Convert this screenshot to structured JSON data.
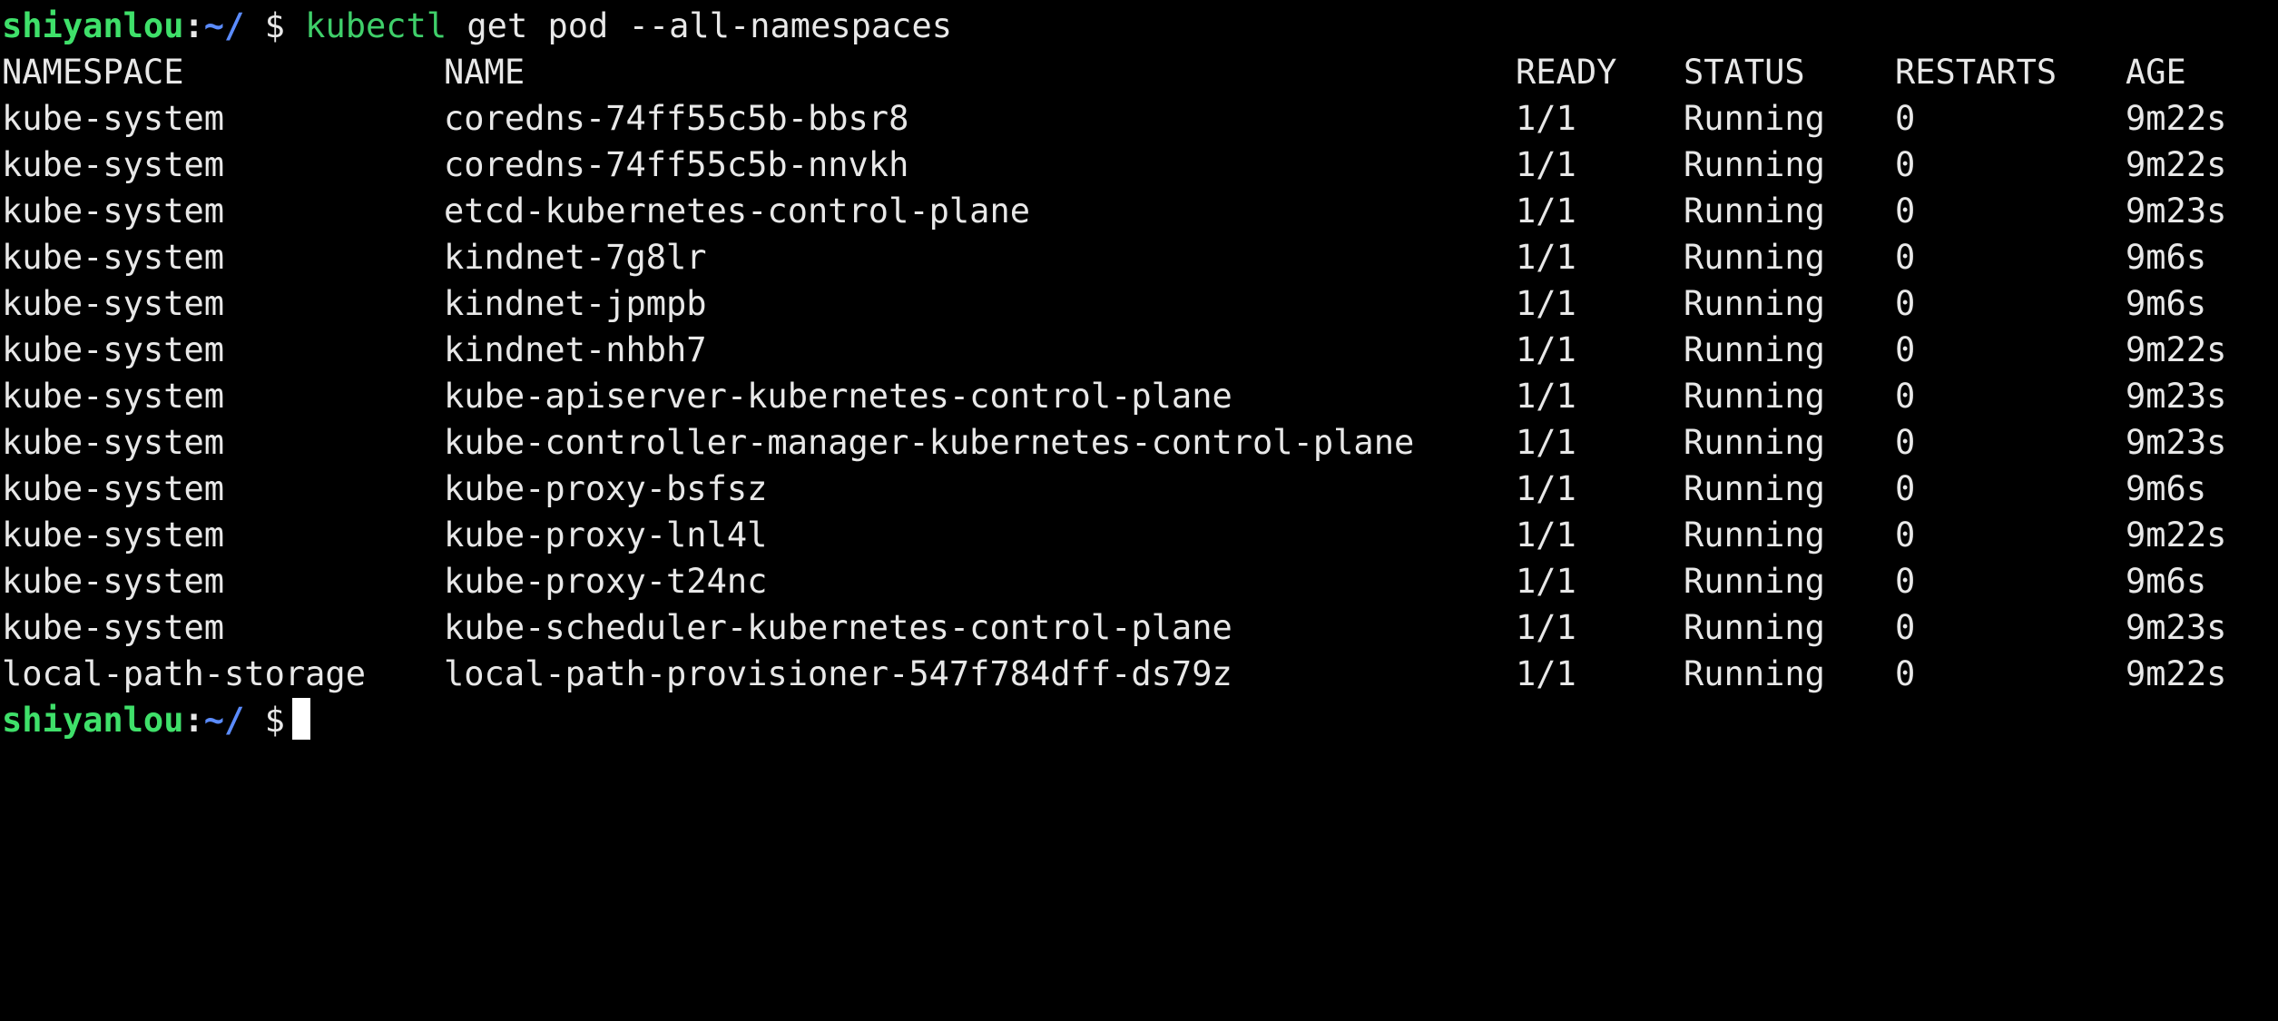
{
  "prompt": {
    "user_host": "shiyanlou",
    "colon": ":",
    "path": "~/",
    "dollar": "$"
  },
  "command": {
    "name": "kubectl",
    "args": "get pod --all-namespaces"
  },
  "table": {
    "headers": {
      "namespace": "NAMESPACE",
      "name": "NAME",
      "ready": "READY",
      "status": "STATUS",
      "restarts": "RESTARTS",
      "age": "AGE"
    },
    "rows": [
      {
        "namespace": "kube-system",
        "name": "coredns-74ff55c5b-bbsr8",
        "ready": "1/1",
        "status": "Running",
        "restarts": "0",
        "age": "9m22s"
      },
      {
        "namespace": "kube-system",
        "name": "coredns-74ff55c5b-nnvkh",
        "ready": "1/1",
        "status": "Running",
        "restarts": "0",
        "age": "9m22s"
      },
      {
        "namespace": "kube-system",
        "name": "etcd-kubernetes-control-plane",
        "ready": "1/1",
        "status": "Running",
        "restarts": "0",
        "age": "9m23s"
      },
      {
        "namespace": "kube-system",
        "name": "kindnet-7g8lr",
        "ready": "1/1",
        "status": "Running",
        "restarts": "0",
        "age": "9m6s"
      },
      {
        "namespace": "kube-system",
        "name": "kindnet-jpmpb",
        "ready": "1/1",
        "status": "Running",
        "restarts": "0",
        "age": "9m6s"
      },
      {
        "namespace": "kube-system",
        "name": "kindnet-nhbh7",
        "ready": "1/1",
        "status": "Running",
        "restarts": "0",
        "age": "9m22s"
      },
      {
        "namespace": "kube-system",
        "name": "kube-apiserver-kubernetes-control-plane",
        "ready": "1/1",
        "status": "Running",
        "restarts": "0",
        "age": "9m23s"
      },
      {
        "namespace": "kube-system",
        "name": "kube-controller-manager-kubernetes-control-plane",
        "ready": "1/1",
        "status": "Running",
        "restarts": "0",
        "age": "9m23s"
      },
      {
        "namespace": "kube-system",
        "name": "kube-proxy-bsfsz",
        "ready": "1/1",
        "status": "Running",
        "restarts": "0",
        "age": "9m6s"
      },
      {
        "namespace": "kube-system",
        "name": "kube-proxy-lnl4l",
        "ready": "1/1",
        "status": "Running",
        "restarts": "0",
        "age": "9m22s"
      },
      {
        "namespace": "kube-system",
        "name": "kube-proxy-t24nc",
        "ready": "1/1",
        "status": "Running",
        "restarts": "0",
        "age": "9m6s"
      },
      {
        "namespace": "kube-system",
        "name": "kube-scheduler-kubernetes-control-plane",
        "ready": "1/1",
        "status": "Running",
        "restarts": "0",
        "age": "9m23s"
      },
      {
        "namespace": "local-path-storage",
        "name": "local-path-provisioner-547f784dff-ds79z",
        "ready": "1/1",
        "status": "Running",
        "restarts": "0",
        "age": "9m22s"
      }
    ]
  },
  "colors": {
    "background": "#000000",
    "text": "#e8e8e8",
    "prompt_user": "#3fe06a",
    "prompt_path": "#5b8cff",
    "command": "#3fcf6a"
  }
}
